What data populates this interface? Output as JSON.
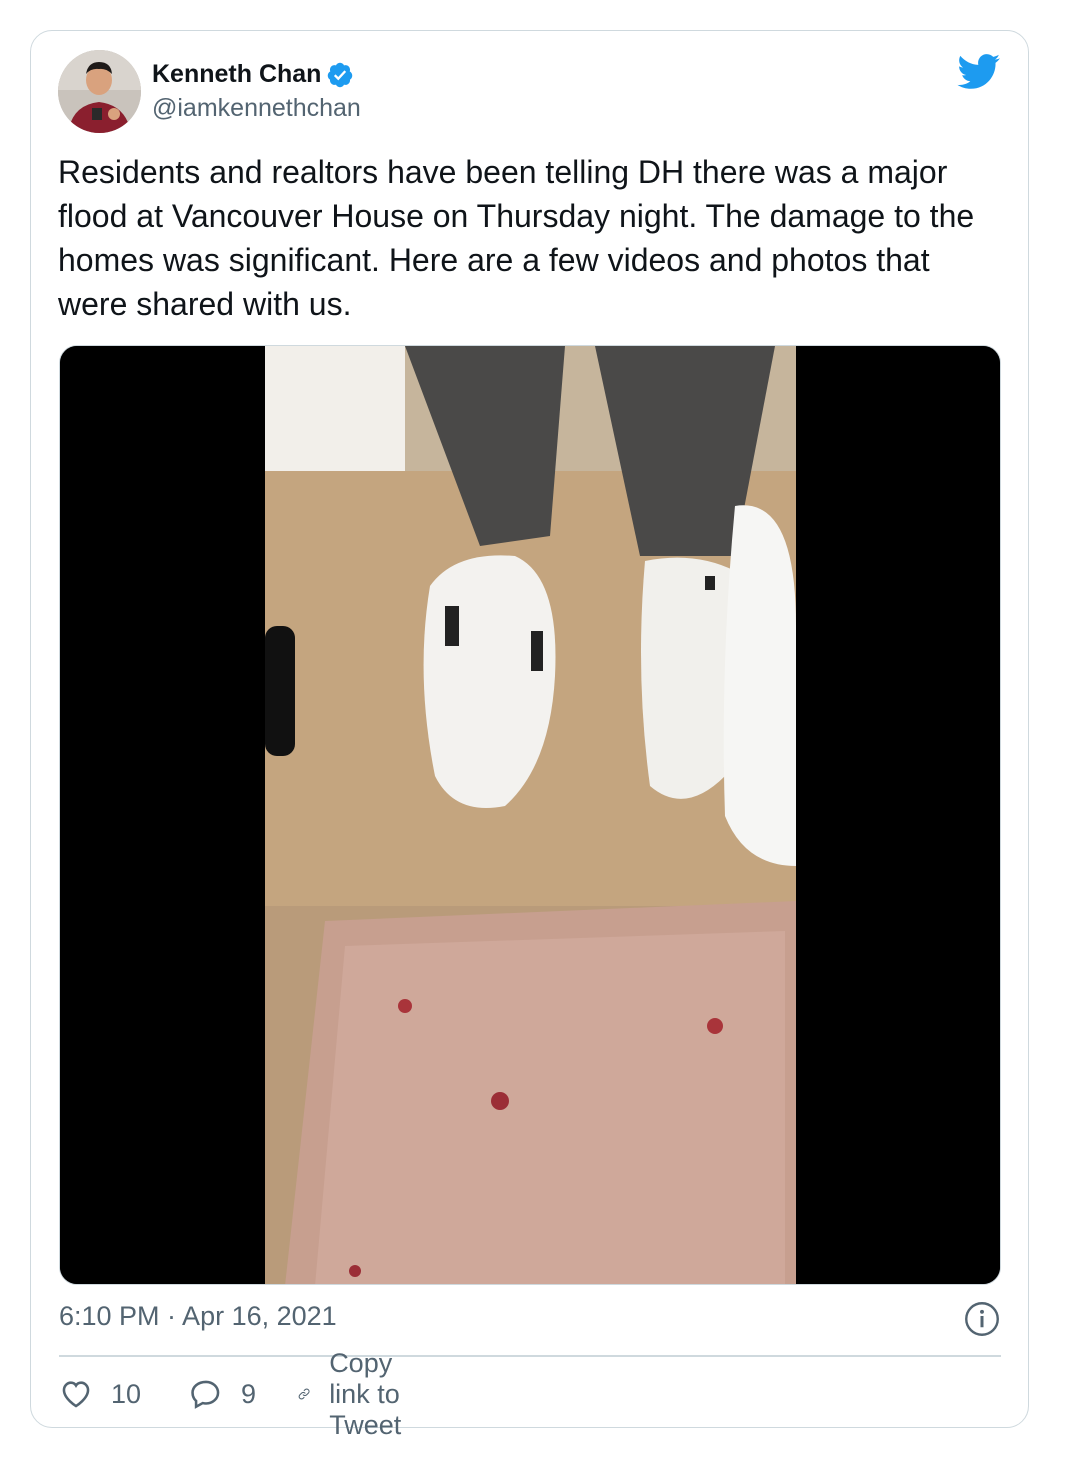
{
  "tweet": {
    "author_name": "Kenneth Chan",
    "author_handle": "@iamkennethchan",
    "text": "Residents and realtors have been telling DH there was a major flood at Vancouver House on Thursday night. The damage to the homes was significant. Here are a few videos and photos that were shared with us.",
    "timestamp": "6:10 PM · Apr 16, 2021",
    "verified_icon": "verified-badge-icon",
    "brand_icon": "twitter-bird-icon"
  },
  "actions": {
    "like_count": "10",
    "reply_count": "9",
    "copy_link_label": "Copy link to Tweet"
  },
  "colors": {
    "brand": "#1d9bf0",
    "text_primary": "#0f1419",
    "text_secondary": "#536471",
    "border": "#cfd9de"
  }
}
